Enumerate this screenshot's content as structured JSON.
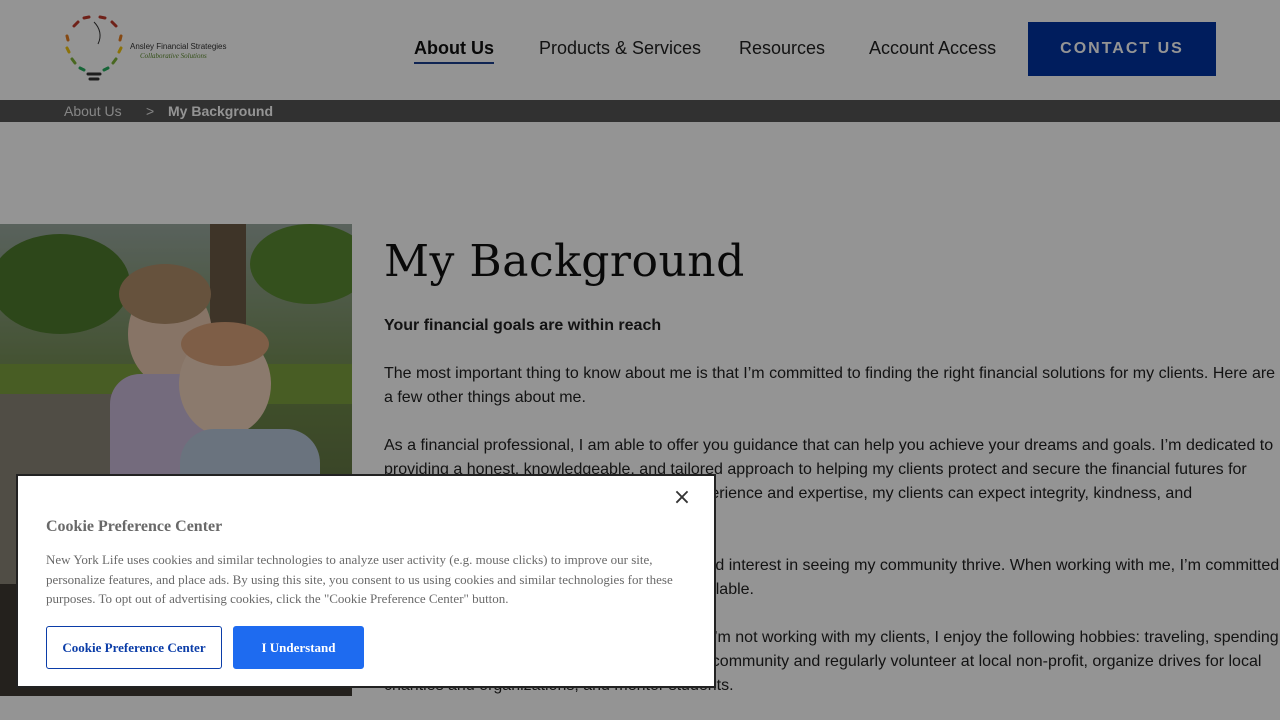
{
  "header": {
    "logo_line1": "Ansley Financial Strategies",
    "logo_line2": "Collaborative Solutions",
    "nav": [
      {
        "label": "About Us",
        "active": true
      },
      {
        "label": "Products & Services"
      },
      {
        "label": "Resources"
      },
      {
        "label": "Account Access"
      }
    ],
    "contact_label": "CONTACT US"
  },
  "breadcrumb": {
    "parent": "About Us",
    "separator": ">",
    "current": "My Background"
  },
  "main": {
    "title": "My Background",
    "lead": "Your financial goals are within reach",
    "paragraphs": [
      "The most important thing to know about me is that I’m committed to finding the right financial solutions for my clients. Here are a few other things about me.",
      "As a financial professional, I am able to offer you guidance that can help you achieve your dreams and goals. I’m dedicated to providing a honest, knowledgeable, and tailored approach to helping my clients protect and secure the financial futures for themselves and their loved ones. With my experience and expertise, my clients can expect integrity, kindness, and professionalism.",
      "As a member of this community, I have a vested interest in seeing my community thrive. When working with me, I’m committed to sharing all of the information that I have available.",
      "I believe in a healthy work-life balance. When I’m not working with my clients, I enjoy the following hobbies: traveling, spending time with family. I am an active member of my community and regularly volunteer at local non-profit, organize drives for local charities and organizations, and mentor students."
    ]
  },
  "cookie": {
    "title": "Cookie Preference Center",
    "text": "New York Life uses cookies and similar technologies to analyze user activity (e.g. mouse clicks) to improve our site, personalize features, and place ads. By using this site, you consent to us using cookies and similar technologies for these purposes. To opt out of advertising cookies, click the \"Cookie Preference Center\" button.",
    "close_symbol": "×",
    "preference_button": "Cookie Preference Center",
    "accept_button": "I Understand"
  },
  "colors": {
    "brand_blue": "#0033a0",
    "accept_blue": "#1e6bf0",
    "breadcrumb_bg": "#555555"
  }
}
